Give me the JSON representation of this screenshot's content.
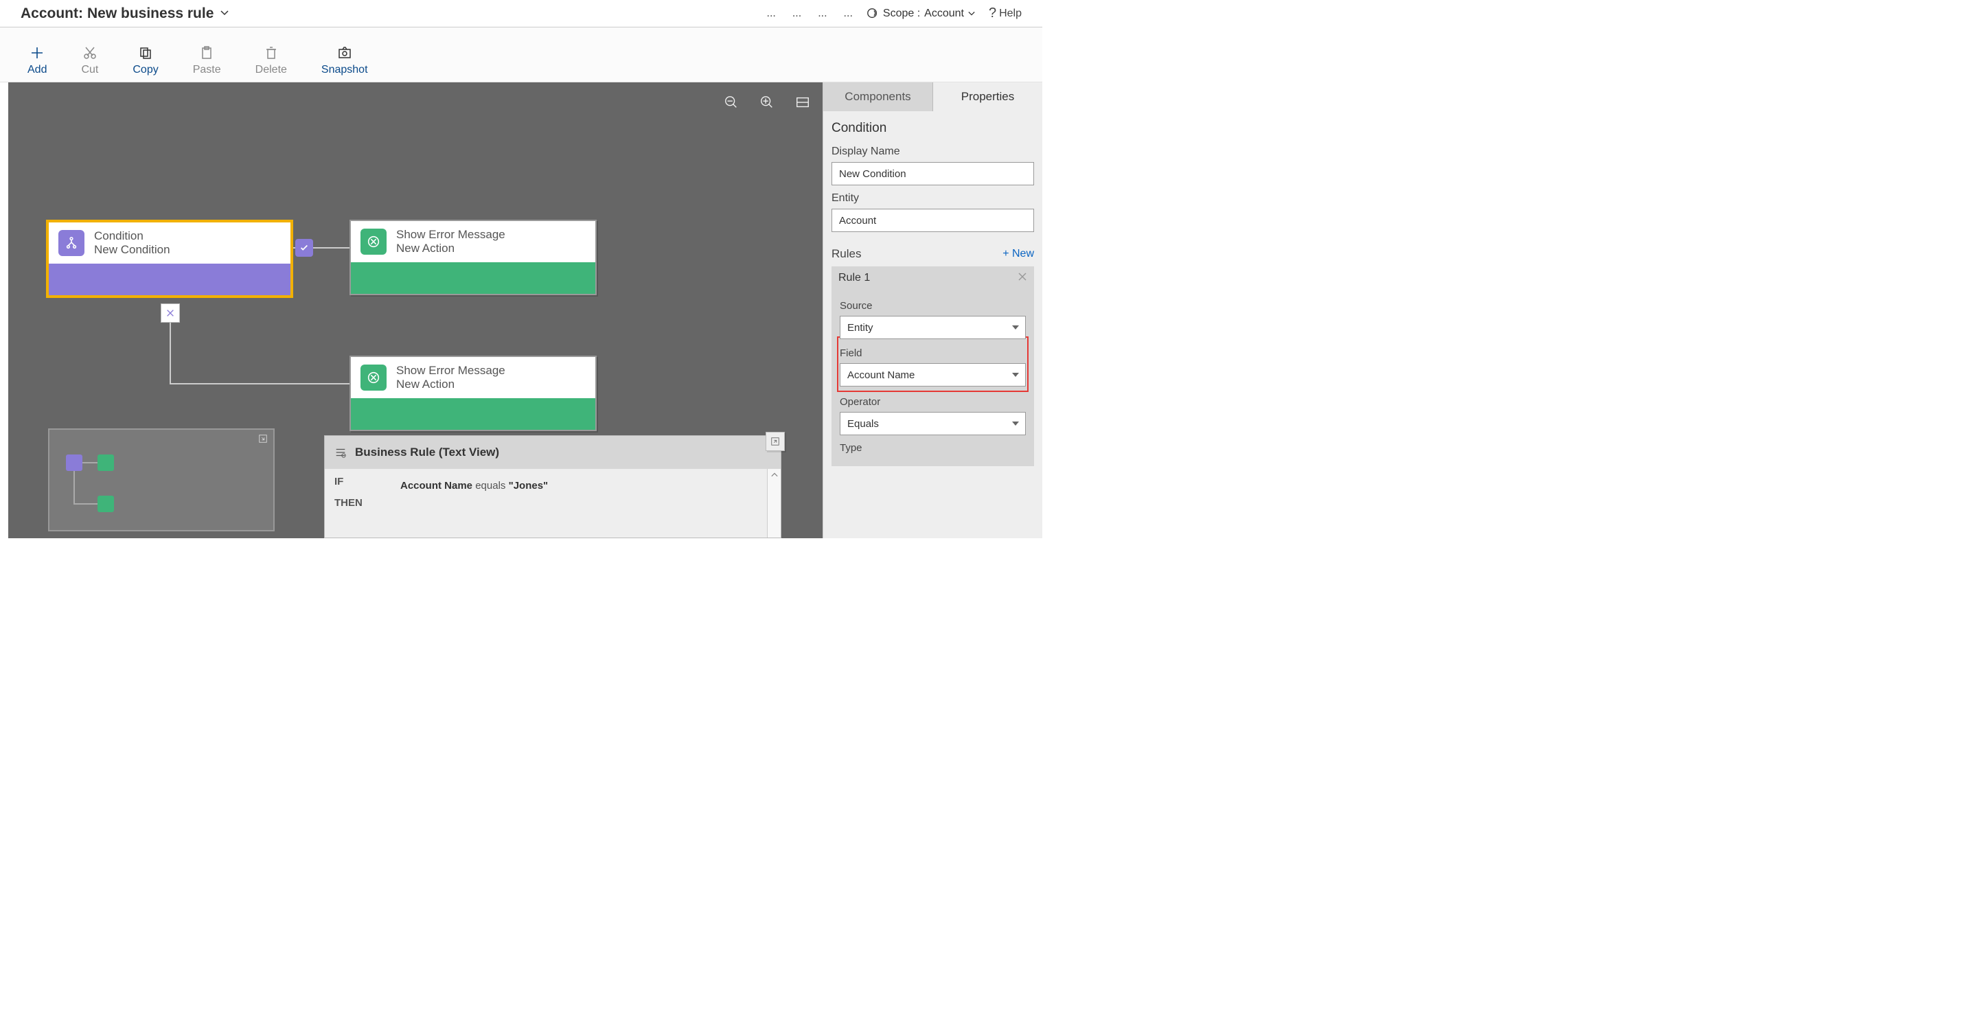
{
  "header": {
    "title_prefix": "Account:",
    "title": "New business rule",
    "scope_label": "Scope :",
    "scope_value": "Account",
    "help": "Help"
  },
  "toolbar": {
    "add": "Add",
    "cut": "Cut",
    "copy": "Copy",
    "paste": "Paste",
    "delete": "Delete",
    "snapshot": "Snapshot"
  },
  "nodes": {
    "condition": {
      "line1": "Condition",
      "line2": "New Condition"
    },
    "action1": {
      "line1": "Show Error Message",
      "line2": "New Action"
    },
    "action2": {
      "line1": "Show Error Message",
      "line2": "New Action"
    }
  },
  "textview": {
    "title": "Business Rule (Text View)",
    "if": "IF",
    "then": "THEN",
    "cond_field": "Account Name",
    "cond_mid": " equals ",
    "cond_val": "\"Jones\""
  },
  "props": {
    "tabs": {
      "components": "Components",
      "properties": "Properties"
    },
    "section": "Condition",
    "display_name_label": "Display Name",
    "display_name_value": "New Condition",
    "entity_label": "Entity",
    "entity_value": "Account",
    "rules_label": "Rules",
    "new_label": "+  New",
    "rule1": "Rule 1",
    "source_label": "Source",
    "source_value": "Entity",
    "field_label": "Field",
    "field_value": "Account Name",
    "operator_label": "Operator",
    "operator_value": "Equals",
    "type_label": "Type"
  }
}
